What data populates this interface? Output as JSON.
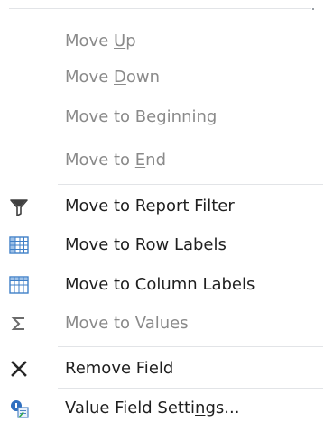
{
  "menu": {
    "items": [
      {
        "pre": "Move ",
        "key": "U",
        "post": "p",
        "enabled": false
      },
      {
        "pre": "Move ",
        "key": "D",
        "post": "own",
        "enabled": false
      },
      {
        "pre": "Move to Be",
        "key": "g",
        "post": "inning",
        "enabled": false
      },
      {
        "pre": "Move to ",
        "key": "E",
        "post": "nd",
        "enabled": false
      },
      {
        "pre": "Move to Report Filter",
        "key": "",
        "post": "",
        "enabled": true,
        "icon": "funnel-filter-icon"
      },
      {
        "pre": "Move to Row Labels",
        "key": "",
        "post": "",
        "enabled": true,
        "icon": "row-labels-grid-icon"
      },
      {
        "pre": "Move to Column Labels",
        "key": "",
        "post": "",
        "enabled": true,
        "icon": "column-labels-grid-icon"
      },
      {
        "pre": "Move to Values",
        "key": "",
        "post": "",
        "enabled": false,
        "icon": "sigma-icon"
      },
      {
        "pre": "Remove Field",
        "key": "",
        "post": "",
        "enabled": true,
        "icon": "remove-x-icon"
      },
      {
        "pre": "Value Field Setti",
        "key": "n",
        "post": "gs...",
        "enabled": true,
        "icon": "field-settings-icon"
      }
    ]
  },
  "colors": {
    "text": "#1f1f1f",
    "disabled_text": "#8a8a8a",
    "separator": "#e2e4e7",
    "grid_blue": "#3f7fc7",
    "grid_header": "#9fc2e8"
  }
}
